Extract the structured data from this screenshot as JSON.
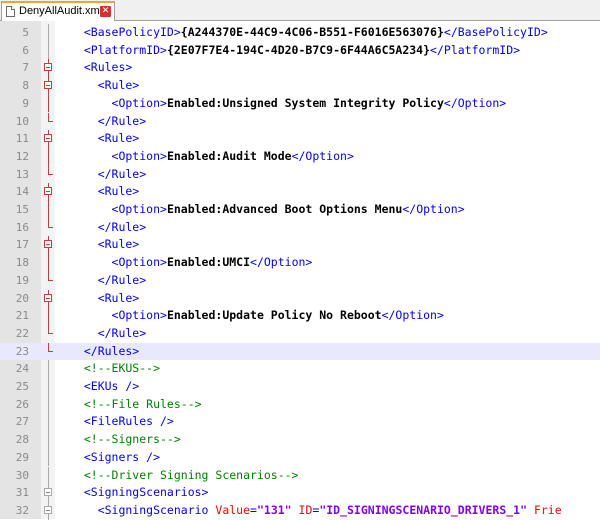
{
  "tab": {
    "filename": "DenyAllAudit.xml",
    "close_icon": "close-icon"
  },
  "lines": [
    {
      "num": "5",
      "tokens": [
        [
          "t-tag",
          "  <BasePolicyID>"
        ],
        [
          "t-str",
          "{A244370E-44C9-4C06-B551-F6016E563076}"
        ],
        [
          "t-tag",
          "</BasePolicyID>"
        ]
      ]
    },
    {
      "num": "6",
      "tokens": [
        [
          "t-tag",
          "  <PlatformID>"
        ],
        [
          "t-str",
          "{2E07F7E4-194C-4D20-B7C9-6F44A6C5A234}"
        ],
        [
          "t-tag",
          "</PlatformID>"
        ]
      ]
    },
    {
      "num": "7",
      "tokens": [
        [
          "t-tag",
          "  <Rules>"
        ]
      ]
    },
    {
      "num": "8",
      "tokens": [
        [
          "t-tag",
          "    <Rule>"
        ]
      ]
    },
    {
      "num": "9",
      "tokens": [
        [
          "t-tag",
          "      <Option>"
        ],
        [
          "t-str",
          "Enabled:Unsigned System Integrity Policy"
        ],
        [
          "t-tag",
          "</Option>"
        ]
      ]
    },
    {
      "num": "10",
      "tokens": [
        [
          "t-tag",
          "    </Rule>"
        ]
      ]
    },
    {
      "num": "11",
      "tokens": [
        [
          "t-tag",
          "    <Rule>"
        ]
      ]
    },
    {
      "num": "12",
      "tokens": [
        [
          "t-tag",
          "      <Option>"
        ],
        [
          "t-str",
          "Enabled:Audit Mode"
        ],
        [
          "t-tag",
          "</Option>"
        ]
      ]
    },
    {
      "num": "13",
      "tokens": [
        [
          "t-tag",
          "    </Rule>"
        ]
      ]
    },
    {
      "num": "14",
      "tokens": [
        [
          "t-tag",
          "    <Rule>"
        ]
      ]
    },
    {
      "num": "15",
      "tokens": [
        [
          "t-tag",
          "      <Option>"
        ],
        [
          "t-str",
          "Enabled:Advanced Boot Options Menu"
        ],
        [
          "t-tag",
          "</Option>"
        ]
      ]
    },
    {
      "num": "16",
      "tokens": [
        [
          "t-tag",
          "    </Rule>"
        ]
      ]
    },
    {
      "num": "17",
      "tokens": [
        [
          "t-tag",
          "    <Rule>"
        ]
      ]
    },
    {
      "num": "18",
      "tokens": [
        [
          "t-tag",
          "      <Option>"
        ],
        [
          "t-str",
          "Enabled:UMCI"
        ],
        [
          "t-tag",
          "</Option>"
        ]
      ]
    },
    {
      "num": "19",
      "tokens": [
        [
          "t-tag",
          "    </Rule>"
        ]
      ]
    },
    {
      "num": "20",
      "tokens": [
        [
          "t-tag",
          "    <Rule>"
        ]
      ]
    },
    {
      "num": "21",
      "tokens": [
        [
          "t-tag",
          "      <Option>"
        ],
        [
          "t-str",
          "Enabled:Update Policy No Reboot"
        ],
        [
          "t-tag",
          "</Option>"
        ]
      ]
    },
    {
      "num": "22",
      "tokens": [
        [
          "t-tag",
          "    </Rule>"
        ]
      ]
    },
    {
      "num": "23",
      "tokens": [
        [
          "t-tag",
          "  </Rules>"
        ]
      ],
      "current": true
    },
    {
      "num": "24",
      "tokens": [
        [
          "t-comment",
          "  <!--EKUS-->"
        ]
      ]
    },
    {
      "num": "25",
      "tokens": [
        [
          "t-tag",
          "  <EKUs />"
        ]
      ]
    },
    {
      "num": "26",
      "tokens": [
        [
          "t-comment",
          "  <!--File Rules-->"
        ]
      ]
    },
    {
      "num": "27",
      "tokens": [
        [
          "t-tag",
          "  <FileRules />"
        ]
      ]
    },
    {
      "num": "28",
      "tokens": [
        [
          "t-comment",
          "  <!--Signers-->"
        ]
      ]
    },
    {
      "num": "29",
      "tokens": [
        [
          "t-tag",
          "  <Signers />"
        ]
      ]
    },
    {
      "num": "30",
      "tokens": [
        [
          "t-comment",
          "  <!--Driver Signing Scenarios-->"
        ]
      ]
    },
    {
      "num": "31",
      "tokens": [
        [
          "t-tag",
          "  <SigningScenarios>"
        ]
      ]
    },
    {
      "num": "32",
      "tokens": [
        [
          "t-tag",
          "    <SigningScenario "
        ],
        [
          "t-attr",
          "Value"
        ],
        [
          "t-tag",
          "="
        ],
        [
          "t-val",
          "\"131\""
        ],
        [
          "t-attr",
          " ID"
        ],
        [
          "t-tag",
          "="
        ],
        [
          "t-val",
          "\"ID_SIGNINGSCENARIO_DRIVERS_1\""
        ],
        [
          "t-attr",
          " Frie"
        ]
      ]
    }
  ],
  "fold": {
    "5": "gline",
    "6": "gline",
    "7": "rbox",
    "8": "rbox",
    "9": "rline",
    "10": "rend",
    "11": "rbox",
    "12": "rline",
    "13": "rend",
    "14": "rbox",
    "15": "rline",
    "16": "rend",
    "17": "rbox",
    "18": "rline",
    "19": "rend",
    "20": "rbox",
    "21": "rline",
    "22": "rend",
    "23": "rend",
    "24": "gline",
    "25": "gline",
    "26": "gline",
    "27": "gline",
    "28": "gline",
    "29": "gline",
    "30": "gline",
    "31": "gbox",
    "32": "gbox"
  }
}
